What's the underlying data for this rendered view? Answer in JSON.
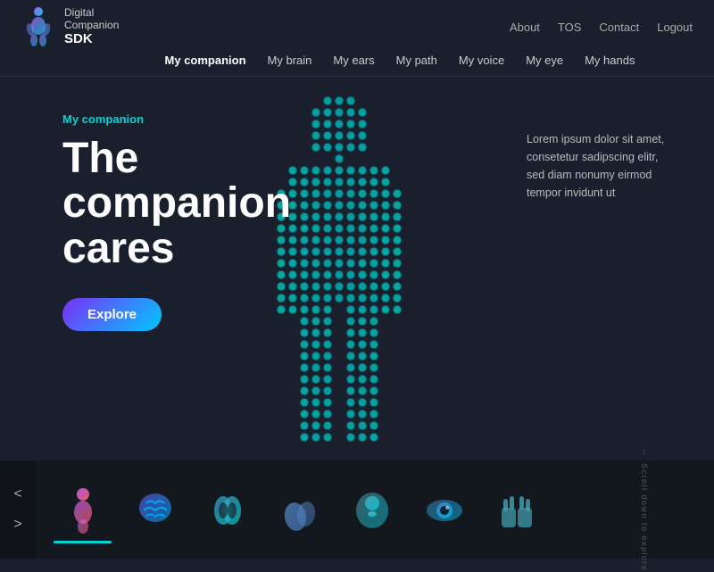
{
  "logo": {
    "line1": "Digital",
    "line2": "Companion",
    "sdk": "SDK"
  },
  "header_links": [
    {
      "label": "About",
      "href": "#"
    },
    {
      "label": "TOS",
      "href": "#"
    },
    {
      "label": "Contact",
      "href": "#"
    },
    {
      "label": "Logout",
      "href": "#"
    }
  ],
  "nav_items": [
    {
      "label": "My companion",
      "active": true
    },
    {
      "label": "My brain",
      "active": false
    },
    {
      "label": "My ears",
      "active": false
    },
    {
      "label": "My path",
      "active": false
    },
    {
      "label": "My voice",
      "active": false
    },
    {
      "label": "My eye",
      "active": false
    },
    {
      "label": "My hands",
      "active": false
    }
  ],
  "hero": {
    "section_label": "My companion",
    "title_line1": "The",
    "title_line2": "companion",
    "title_line3": "cares",
    "description": "Lorem ipsum dolor sit amet, consetetur sadipscing elitr, sed diam nonumy eirmod tempor invidunt ut",
    "cta_label": "Explore"
  },
  "scroll_text": "Scroll down to explore",
  "bottom_thumbs": [
    {
      "label": "companion",
      "active": true,
      "color": "#b06cff"
    },
    {
      "label": "brain",
      "active": false,
      "color": "#5c6fff"
    },
    {
      "label": "ears",
      "active": false,
      "color": "#4a9ccc"
    },
    {
      "label": "path",
      "active": false,
      "color": "#5a8fcc"
    },
    {
      "label": "voice",
      "active": false,
      "color": "#5aaabb"
    },
    {
      "label": "eye",
      "active": false,
      "color": "#4488cc"
    },
    {
      "label": "hands",
      "active": false,
      "color": "#5599aa"
    }
  ]
}
